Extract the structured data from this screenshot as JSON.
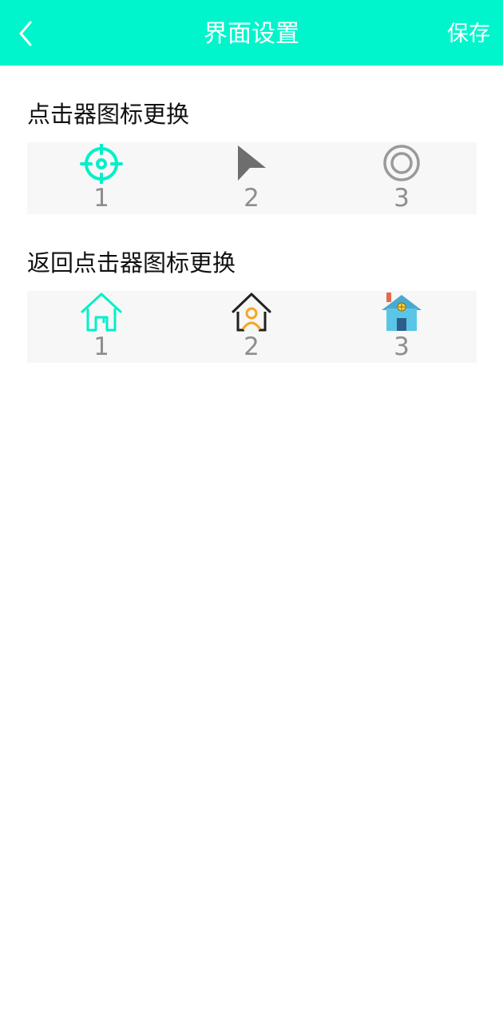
{
  "header": {
    "title": "界面设置",
    "save_label": "保存",
    "back_icon": "chevron-left-icon",
    "background": "#00F5CC"
  },
  "clicker_section": {
    "title": "点击器图标更换",
    "options": [
      {
        "label": "1",
        "icon": "crosshair-icon",
        "color": "#00F0C8"
      },
      {
        "label": "2",
        "icon": "arrow-pointer-icon",
        "color": "#6E6E6E"
      },
      {
        "label": "3",
        "icon": "target-ring-icon",
        "color": "#9A9A9A"
      }
    ]
  },
  "return_section": {
    "title": "返回点击器图标更换",
    "options": [
      {
        "label": "1",
        "icon": "home-outline-icon",
        "color": "#00F0C8"
      },
      {
        "label": "2",
        "icon": "home-person-icon",
        "color": "#222222"
      },
      {
        "label": "3",
        "icon": "home-chimney-icon",
        "color": "#5BC5E8"
      }
    ]
  }
}
